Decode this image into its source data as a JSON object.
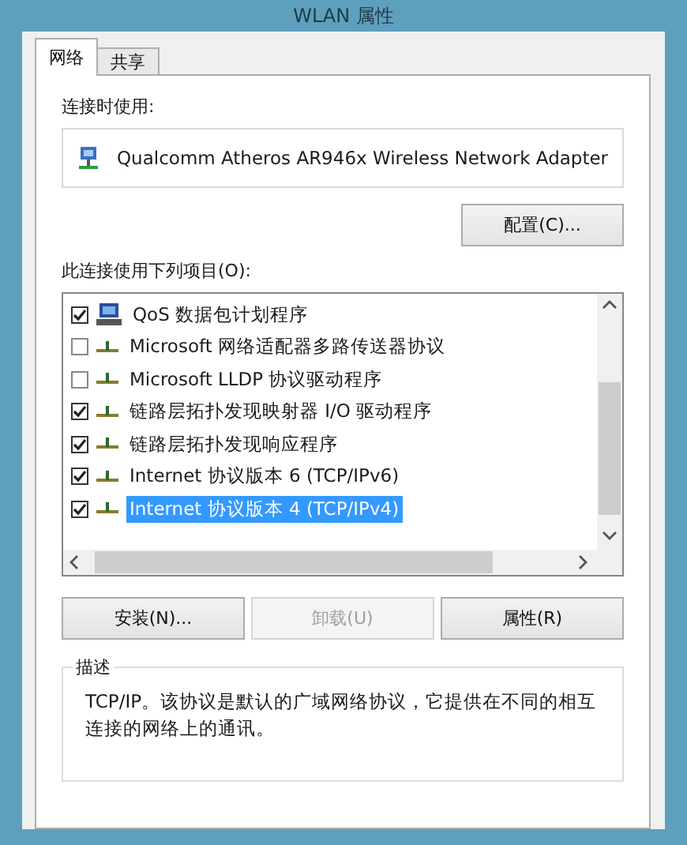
{
  "window": {
    "title": "WLAN 属性"
  },
  "tabs": [
    {
      "label": "网络",
      "selected": true
    },
    {
      "label": "共享",
      "selected": false
    }
  ],
  "connect_using": {
    "label": "连接时使用:",
    "adapter": "Qualcomm Atheros AR946x Wireless Network Adapter",
    "configure_button": "配置(C)..."
  },
  "items_label": "此连接使用下列项目(O):",
  "items": [
    {
      "label": "QoS 数据包计划程序",
      "checked": true,
      "selected": false,
      "kind": "scheduler"
    },
    {
      "label": "Microsoft 网络适配器多路传送器协议",
      "checked": false,
      "selected": false,
      "kind": "protocol"
    },
    {
      "label": "Microsoft LLDP 协议驱动程序",
      "checked": false,
      "selected": false,
      "kind": "protocol"
    },
    {
      "label": "链路层拓扑发现映射器 I/O 驱动程序",
      "checked": true,
      "selected": false,
      "kind": "protocol"
    },
    {
      "label": "链路层拓扑发现响应程序",
      "checked": true,
      "selected": false,
      "kind": "protocol"
    },
    {
      "label": "Internet 协议版本 6 (TCP/IPv6)",
      "checked": true,
      "selected": false,
      "kind": "protocol"
    },
    {
      "label": "Internet 协议版本 4 (TCP/IPv4)",
      "checked": true,
      "selected": true,
      "kind": "protocol"
    }
  ],
  "buttons": [
    {
      "label": "安装(N)...",
      "disabled": false
    },
    {
      "label": "卸载(U)",
      "disabled": true
    },
    {
      "label": "属性(R)",
      "disabled": false
    }
  ],
  "description": {
    "title": "描述",
    "text": "TCP/IP。该协议是默认的广域网络协议，它提供在不同的相互连接的网络上的通讯。"
  }
}
